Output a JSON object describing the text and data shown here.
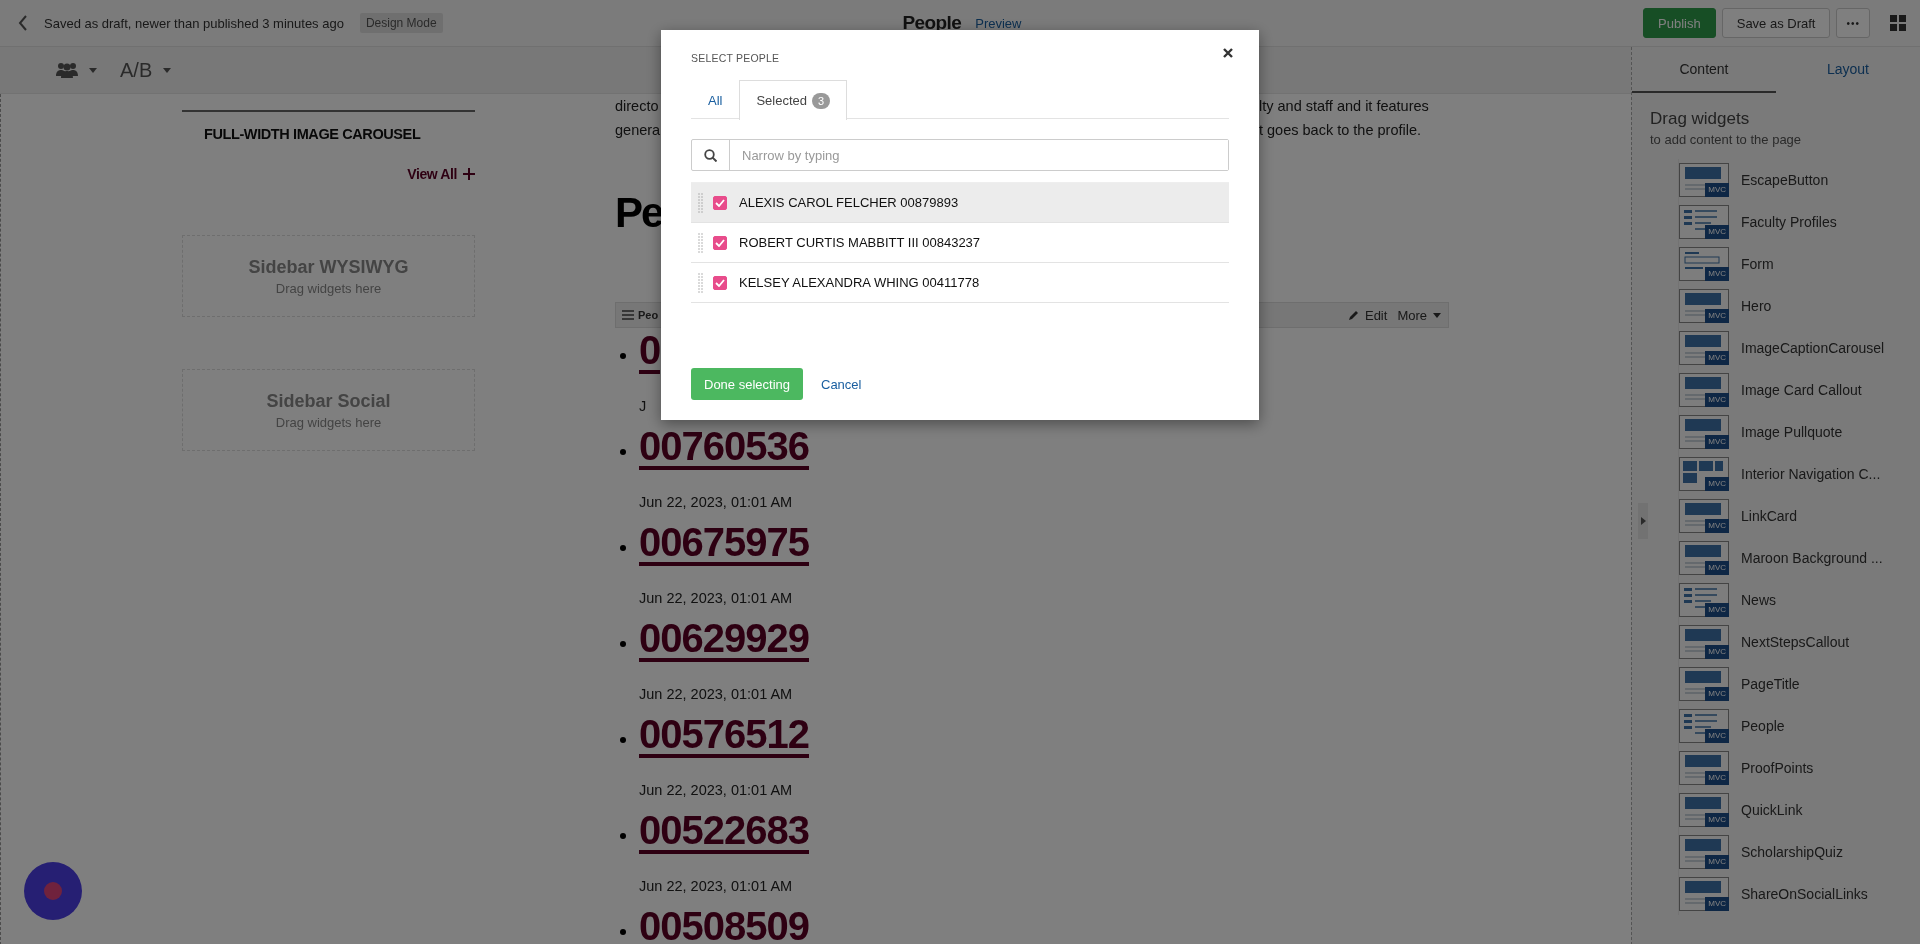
{
  "top_bar": {
    "status": "Saved as draft, newer than published 3 minutes ago",
    "mode_badge": "Design Mode",
    "page_title": "People",
    "preview_link": "Preview",
    "buttons": [
      {
        "label": "Publish",
        "kind": "primary"
      },
      {
        "label": "Save as Draft",
        "kind": "default"
      },
      {
        "label": "•••",
        "kind": "compact"
      }
    ]
  },
  "toolbar": {
    "ab_label": "A/B"
  },
  "left_sidebar": {
    "heading": "FULL-WIDTH IMAGE CAROUSEL",
    "view_all": "View All",
    "drop_zones": [
      {
        "title": "Sidebar WYSIWYG",
        "hint": "Drag widgets here"
      },
      {
        "title": "Sidebar Social",
        "hint": "Drag widgets here"
      }
    ]
  },
  "main": {
    "intro_lines": [
      {
        "start": "directo",
        "end": "lty and staff and it features"
      },
      {
        "start": "genera",
        "end": "t goes back to the profile."
      }
    ],
    "heading": "Pe",
    "widget_bar": {
      "label": "Peo",
      "edit": "Edit",
      "more": "More"
    },
    "items": [
      {
        "number": "0",
        "date": "J"
      },
      {
        "number": "00760536",
        "date": "Jun 22, 2023, 01:01 AM"
      },
      {
        "number": "00675975",
        "date": "Jun 22, 2023, 01:01 AM"
      },
      {
        "number": "00629929",
        "date": "Jun 22, 2023, 01:01 AM"
      },
      {
        "number": "00576512",
        "date": "Jun 22, 2023, 01:01 AM"
      },
      {
        "number": "00522683",
        "date": "Jun 22, 2023, 01:01 AM"
      },
      {
        "number": "00508509"
      }
    ]
  },
  "right_panel": {
    "tabs": [
      {
        "label": "Content",
        "selected": true
      },
      {
        "label": "Layout",
        "selected": false
      }
    ],
    "heading": "Drag widgets",
    "subheading": "to add content to the page",
    "widgets": [
      {
        "name": "EscapeButton",
        "badge": "MVC",
        "kind": "banner"
      },
      {
        "name": "Faculty Profiles",
        "badge": "MVC",
        "kind": "list"
      },
      {
        "name": "Form",
        "badge": "MVC",
        "kind": "form"
      },
      {
        "name": "Hero",
        "badge": "MVC",
        "kind": "banner"
      },
      {
        "name": "ImageCaptionCarousel",
        "badge": "MVC",
        "kind": "banner"
      },
      {
        "name": "Image Card Callout",
        "badge": "MVC",
        "kind": "banner"
      },
      {
        "name": "Image Pullquote",
        "badge": "MVC",
        "kind": "banner"
      },
      {
        "name": "Interior Navigation C...",
        "badge": "MVC",
        "kind": "grid"
      },
      {
        "name": "LinkCard",
        "badge": "MVC",
        "kind": "banner"
      },
      {
        "name": "Maroon Background ...",
        "badge": "MVC",
        "kind": "banner"
      },
      {
        "name": "News",
        "badge": "MVC",
        "kind": "list"
      },
      {
        "name": "NextStepsCallout",
        "badge": "MVC",
        "kind": "banner"
      },
      {
        "name": "PageTitle",
        "badge": "MVC",
        "kind": "banner"
      },
      {
        "name": "People",
        "badge": "MVC",
        "kind": "list"
      },
      {
        "name": "ProofPoints",
        "badge": "MVC",
        "kind": "banner"
      },
      {
        "name": "QuickLink",
        "badge": "MVC",
        "kind": "banner"
      },
      {
        "name": "ScholarshipQuiz",
        "badge": "MVC",
        "kind": "banner"
      },
      {
        "name": "ShareOnSocialLinks",
        "badge": "MVC",
        "kind": "banner"
      }
    ]
  },
  "dialog": {
    "title": "SELECT PEOPLE",
    "tabs": [
      {
        "label": "All",
        "selected": false
      },
      {
        "label": "Selected",
        "count": "3",
        "selected": true
      }
    ],
    "search": {
      "placeholder": "Narrow by typing"
    },
    "people": [
      {
        "name": "ALEXIS CAROL FELCHER 00879893",
        "checked": true,
        "selected": true
      },
      {
        "name": "ROBERT CURTIS MABBITT III 00843237",
        "checked": true,
        "selected": false
      },
      {
        "name": "KELSEY ALEXANDRA WHING 00411778",
        "checked": true,
        "selected": false
      }
    ],
    "buttons": [
      {
        "label": "Done selecting",
        "kind": "primary"
      },
      {
        "label": "Cancel",
        "kind": "link"
      }
    ]
  }
}
